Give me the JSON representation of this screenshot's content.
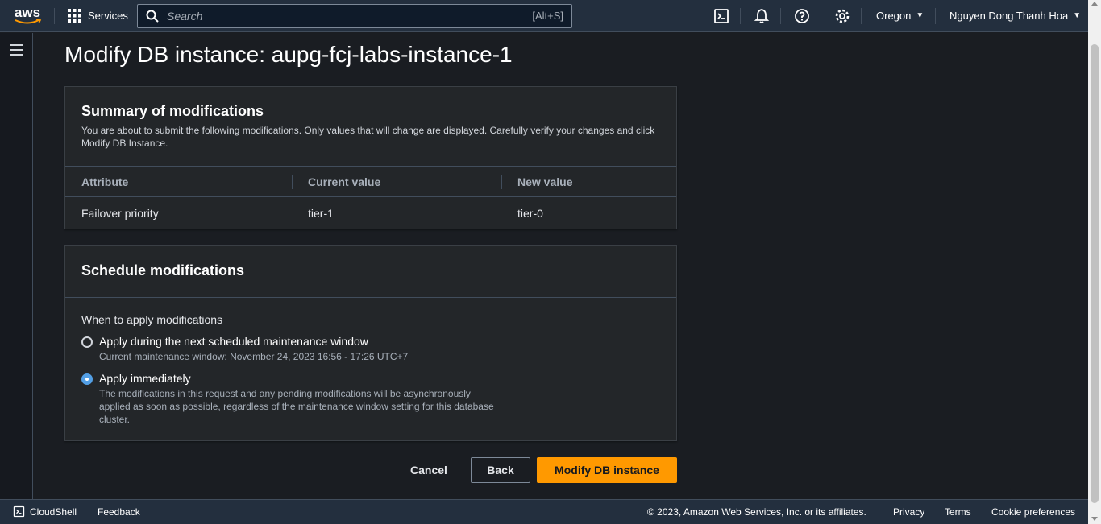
{
  "topnav": {
    "logo_text": "aws",
    "services_label": "Services",
    "search_placeholder": "Search",
    "search_shortcut": "[Alt+S]",
    "region": "Oregon",
    "user": "Nguyen Dong Thanh Hoa"
  },
  "page": {
    "title": "Modify DB instance: aupg-fcj-labs-instance-1"
  },
  "summary": {
    "title": "Summary of modifications",
    "description": "You are about to submit the following modifications. Only values that will change are displayed. Carefully verify your changes and click Modify DB Instance.",
    "columns": [
      "Attribute",
      "Current value",
      "New value"
    ],
    "rows": [
      {
        "attribute": "Failover priority",
        "current": "tier-1",
        "new": "tier-0"
      }
    ]
  },
  "schedule": {
    "title": "Schedule modifications",
    "field_label": "When to apply modifications",
    "options": [
      {
        "label": "Apply during the next scheduled maintenance window",
        "description": "Current maintenance window: November 24, 2023 16:56 - 17:26 UTC+7",
        "checked": false
      },
      {
        "label": "Apply immediately",
        "description": "The modifications in this request and any pending modifications will be asynchronously applied as soon as possible, regardless of the maintenance window setting for this database cluster.",
        "checked": true
      }
    ]
  },
  "actions": {
    "cancel": "Cancel",
    "back": "Back",
    "submit": "Modify DB instance"
  },
  "footer": {
    "cloudshell": "CloudShell",
    "feedback": "Feedback",
    "copyright": "© 2023, Amazon Web Services, Inc. or its affiliates.",
    "privacy": "Privacy",
    "terms": "Terms",
    "cookies": "Cookie preferences"
  },
  "colors": {
    "nav_bg": "#232f3e",
    "page_bg": "#1a1d22",
    "panel_bg": "#232629",
    "primary": "#ff9900",
    "radio_selected": "#539fe5"
  },
  "icons": [
    "aws-logo",
    "grid-icon",
    "search-icon",
    "cloudshell-icon",
    "bell-icon",
    "help-icon",
    "gear-icon",
    "hamburger-icon"
  ]
}
